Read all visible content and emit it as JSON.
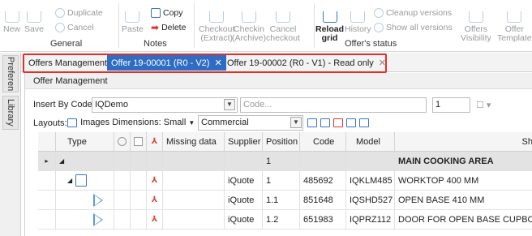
{
  "ribbon": {
    "new": "New",
    "save": "Save",
    "duplicate": "Duplicate",
    "cancel": "Cancel",
    "paste": "Paste",
    "copy": "Copy",
    "delete": "Delete",
    "checkout_l1": "Checkout",
    "checkout_l2": "(Extract)",
    "checkin_l1": "Checkin",
    "checkin_l2": "(Archive)",
    "cancel_checkout_l1": "Cancel",
    "cancel_checkout_l2": "checkout",
    "reload_l1": "Reload",
    "reload_l2": "grid",
    "history": "History",
    "cleanup": "Cleanup versions",
    "show_all_versions": "Show all versions",
    "offers_visibility_l1": "Offers",
    "offers_visibility_l2": "Visibility",
    "offer_templates_l1": "Offer",
    "offer_templates_l2": "Template",
    "group_general": "General",
    "group_notes": "Notes",
    "group_offer_status": "Offer's status"
  },
  "side_tabs": [
    "Preferen",
    "Library"
  ],
  "tabs": [
    {
      "label": "Offers Management",
      "active": false,
      "closable": false
    },
    {
      "label": "Offer 19-00001 (R0 - V2)",
      "active": true,
      "closable": true
    },
    {
      "label": "Offer 19-00002 (R0 - V1) - Read only",
      "active": false,
      "closable": true
    }
  ],
  "panel": {
    "title": "Offer Management",
    "insert_by_code_label": "Insert By Code",
    "insert_by_code_value": "IQDemo",
    "code_placeholder": "Code...",
    "quantity_value": "1",
    "layouts_label": "Layouts:",
    "images_dimensions_label": "Images Dimensions:",
    "images_dimensions_value": "Small",
    "commercial_value": "Commercial"
  },
  "grid": {
    "headers": {
      "type": "Type",
      "missing_data": "Missing data",
      "supplier": "Supplier",
      "position": "Position",
      "code": "Code",
      "model": "Model",
      "short_desc": "Sh"
    },
    "rows": [
      {
        "kind": "section",
        "supplier": "",
        "position": "1",
        "code": "",
        "model": "",
        "desc": "MAIN COOKING AREA"
      },
      {
        "kind": "item",
        "supplier": "iQuote",
        "position": "1",
        "code": "485692",
        "model": "IQKLM485",
        "desc": "WORKTOP 400 MM"
      },
      {
        "kind": "sub",
        "supplier": "iQuote",
        "position": "1.1",
        "code": "851648",
        "model": "IQSHD527",
        "desc": "OPEN BASE 410 MM"
      },
      {
        "kind": "sub",
        "supplier": "iQuote",
        "position": "1.2",
        "code": "651983",
        "model": "IQPRZ112",
        "desc": "DOOR FOR OPEN BASE CUPBOARD"
      }
    ]
  },
  "colors": {
    "accent": "#2f6dc4",
    "highlight_border": "#e0302b",
    "section_row": "#e3e3e3"
  }
}
